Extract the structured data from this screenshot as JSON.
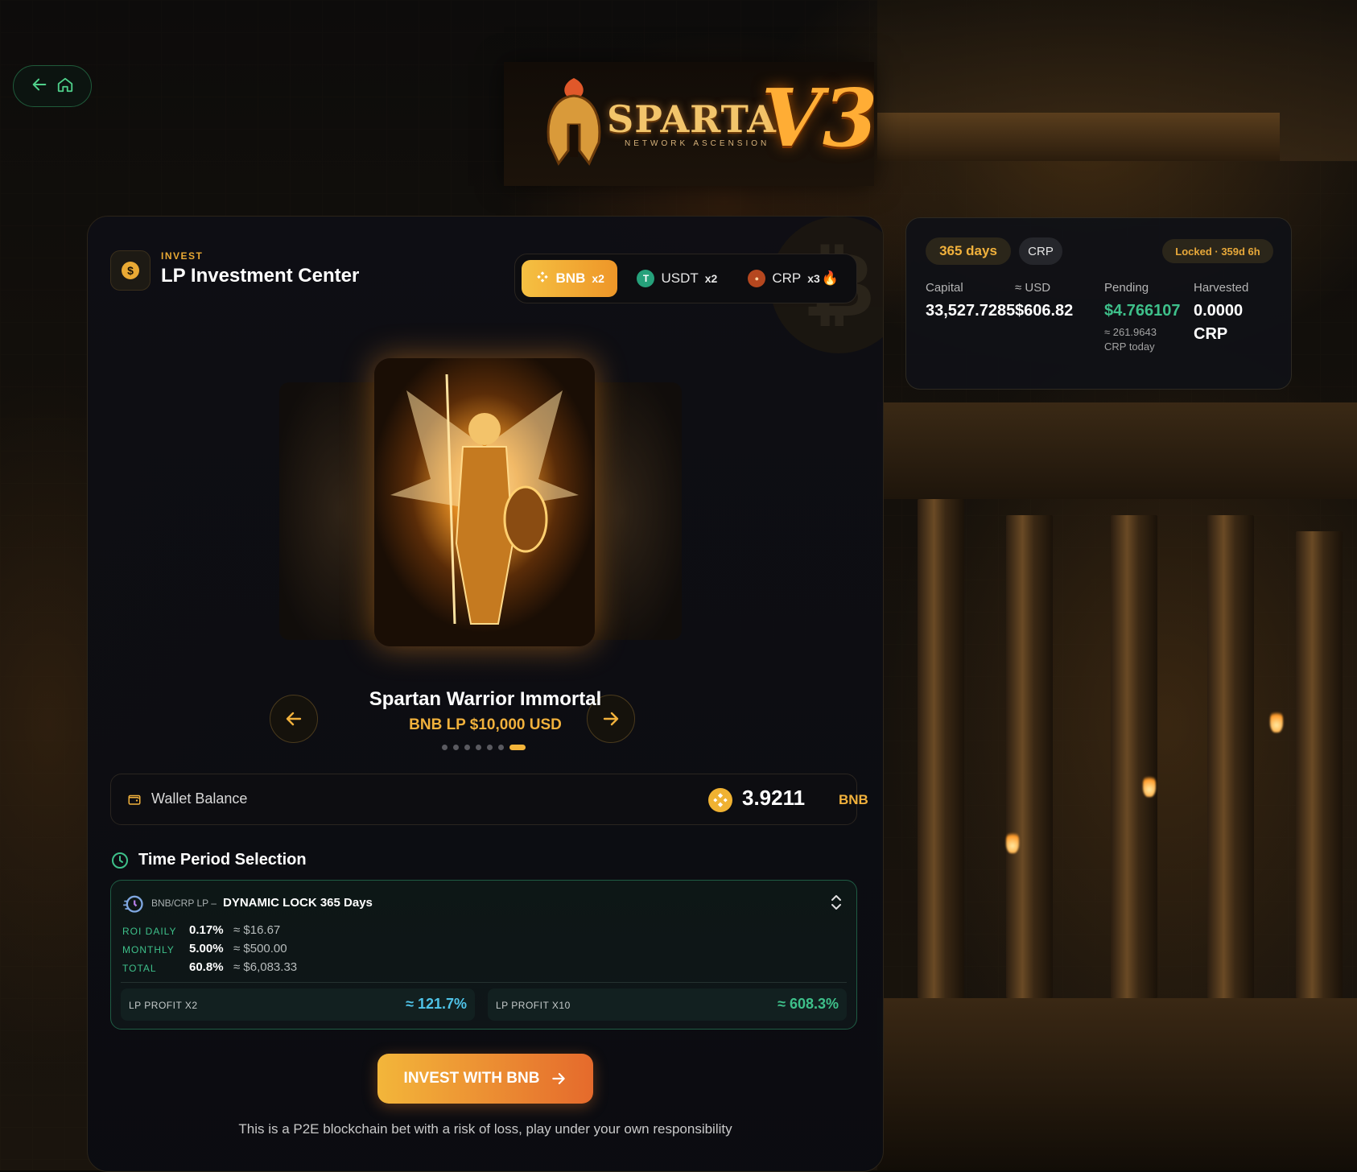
{
  "nav": {
    "back_icon": "arrow-left-icon",
    "home_icon": "home-icon"
  },
  "logo": {
    "brand": "SPARTA",
    "version": "V3",
    "tagline": "NETWORK ASCENSION"
  },
  "header": {
    "kicker": "INVEST",
    "title": "LP Investment Center",
    "icon": "dollar-coin-icon"
  },
  "tabs": [
    {
      "label": "BNB",
      "mult": "x2",
      "icon": "bnb-icon",
      "active": true
    },
    {
      "label": "USDT",
      "mult": "x2",
      "icon": "tether-icon",
      "active": false
    },
    {
      "label": "CRP",
      "mult": "x3",
      "icon": "crp-icon",
      "suffix": "🔥",
      "active": false
    }
  ],
  "carousel": {
    "title": "Spartan Warrior Immortal",
    "subtitle": "BNB LP $10,000 USD",
    "dots": 7,
    "active_dot": 7
  },
  "wallet": {
    "label": "Wallet Balance",
    "value": "3.9211",
    "unit": "BNB"
  },
  "period": {
    "title": "Time Period Selection",
    "pair": "BNB/CRP LP –",
    "lock": "DYNAMIC LOCK 365 Days",
    "rows": [
      {
        "label": "ROI DAILY",
        "pct": "0.17%",
        "usd": "≈ $16.67"
      },
      {
        "label": "MONTHLY",
        "pct": "5.00%",
        "usd": "≈ $500.00"
      },
      {
        "label": "TOTAL",
        "pct": "60.8%",
        "usd": "≈ $6,083.33"
      }
    ],
    "lp_x2": {
      "label": "LP PROFIT X2",
      "value": "≈ 121.7%"
    },
    "lp_x10": {
      "label": "LP PROFIT X10",
      "value": "≈ 608.3%"
    }
  },
  "invest_button": "INVEST WITH BNB",
  "disclaimer": "This is a P2E blockchain bet with a risk of loss, play under your own responsibility",
  "stats": {
    "days_pill": "365 days",
    "token_pill": "CRP",
    "locked_pill": "Locked · 359d 6h",
    "capital_label": "Capital",
    "capital_value": "33,527.7285",
    "usd_label": "≈ USD",
    "usd_value": "$606.82",
    "pending_label": "Pending",
    "pending_value": "$4.766107",
    "pending_sub1": "≈ 261.9643",
    "pending_sub2": "CRP today",
    "harvested_label": "Harvested",
    "harvested_value": "0.0000",
    "harvested_unit": "CRP"
  },
  "colors": {
    "accent": "#f1b13c",
    "green": "#3ec08a",
    "bg": "#0b0906"
  }
}
